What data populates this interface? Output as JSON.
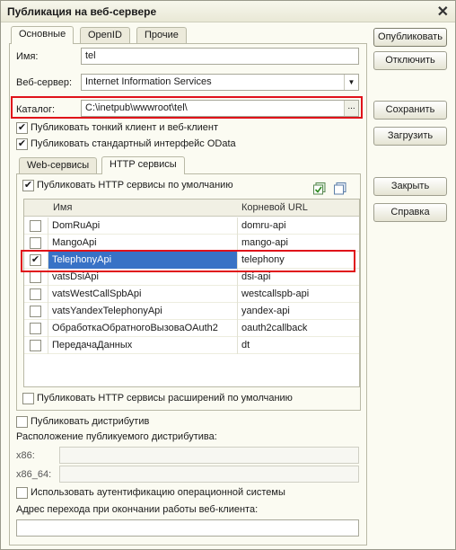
{
  "window": {
    "title": "Публикация на веб-сервере"
  },
  "tabs": [
    {
      "label": "Основные"
    },
    {
      "label": "OpenID"
    },
    {
      "label": "Прочие"
    }
  ],
  "fields": {
    "name_label": "Имя:",
    "name_value": "tel",
    "webserver_label": "Веб-сервер:",
    "webserver_value": "Internet Information Services",
    "catalog_label": "Каталог:",
    "catalog_value": "C:\\inetpub\\wwwroot\\tel\\",
    "catalog_button": "..."
  },
  "checks": {
    "thin_client": {
      "label": "Публиковать тонкий клиент и веб-клиент",
      "checked": true
    },
    "odata": {
      "label": "Публиковать стандартный интерфейс OData",
      "checked": true
    }
  },
  "subtabs": [
    {
      "label": "Web-сервисы"
    },
    {
      "label": "HTTP сервисы"
    }
  ],
  "http": {
    "publish_default": {
      "label": "Публиковать HTTP сервисы по умолчанию",
      "checked": true
    },
    "columns": [
      "Имя",
      "Корневой URL"
    ],
    "rows": [
      {
        "name": "DomRuApi",
        "url": "domru-api",
        "checked": false
      },
      {
        "name": "MangoApi",
        "url": "mango-api",
        "checked": false
      },
      {
        "name": "TelephonyApi",
        "url": "telephony",
        "checked": true
      },
      {
        "name": "vatsDsiApi",
        "url": "dsi-api",
        "checked": false
      },
      {
        "name": "vatsWestCallSpbApi",
        "url": "westcallspb-api",
        "checked": false
      },
      {
        "name": "vatsYandexTelephonyApi",
        "url": "yandex-api",
        "checked": false
      },
      {
        "name": "ОбработкаОбратногоВызоваOAuth2",
        "url": "oauth2callback",
        "checked": false
      },
      {
        "name": "ПередачаДанных",
        "url": "dt",
        "checked": false
      }
    ],
    "publish_extensions": {
      "label": "Публиковать HTTP сервисы расширений по умолчанию",
      "checked": false
    }
  },
  "distrib": {
    "publish": {
      "label": "Публиковать дистрибутив",
      "checked": false
    },
    "location_label": "Расположение публикуемого дистрибутива:",
    "x86_label": "x86:",
    "x86_64_label": "x86_64:",
    "x86_value": "",
    "x86_64_value": ""
  },
  "auth": {
    "label": "Использовать аутентификацию операционной системы",
    "checked": false
  },
  "exit_url": {
    "label": "Адрес перехода при окончании работы веб-клиента:",
    "value": ""
  },
  "buttons": {
    "publish": "Опубликовать",
    "disable": "Отключить",
    "save": "Сохранить",
    "load": "Загрузить",
    "close": "Закрыть",
    "help": "Справка"
  },
  "icons": {
    "close": "close-icon",
    "check_all": "check-all-icon",
    "uncheck_all": "uncheck-all-icon"
  },
  "colors": {
    "highlight_border": "#e0121a",
    "selection": "#3872c6"
  }
}
